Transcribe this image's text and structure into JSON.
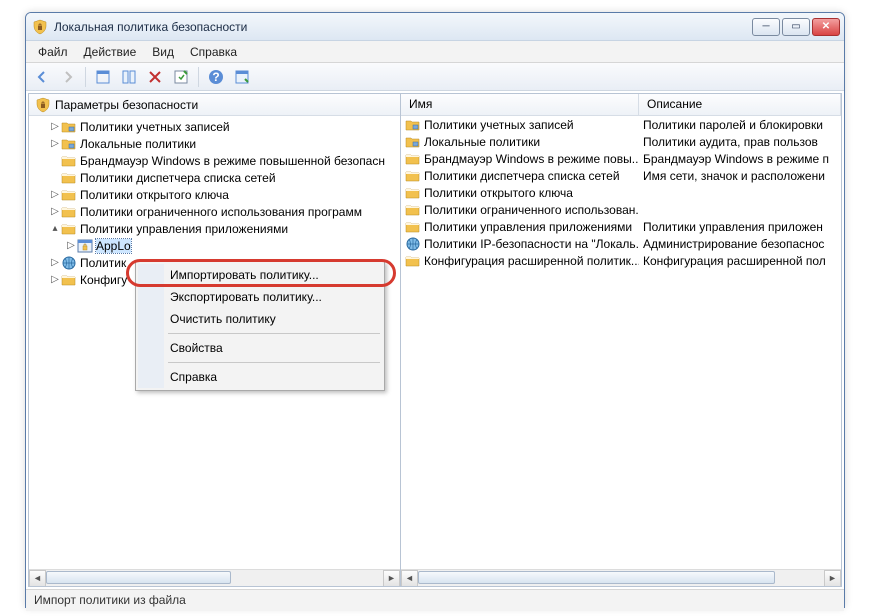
{
  "window": {
    "title": "Локальная политика безопасности"
  },
  "menubar": [
    "Файл",
    "Действие",
    "Вид",
    "Справка"
  ],
  "tree_header": "Параметры безопасности",
  "tree": [
    {
      "depth": 1,
      "exp": "▷",
      "icon": "folder-group",
      "label": "Политики учетных записей"
    },
    {
      "depth": 1,
      "exp": "▷",
      "icon": "folder-group",
      "label": "Локальные политики"
    },
    {
      "depth": 1,
      "exp": "",
      "icon": "folder",
      "label": "Брандмауэр Windows в режиме повышенной безопасн"
    },
    {
      "depth": 1,
      "exp": "",
      "icon": "folder",
      "label": "Политики диспетчера списка сетей"
    },
    {
      "depth": 1,
      "exp": "▷",
      "icon": "folder",
      "label": "Политики открытого ключа"
    },
    {
      "depth": 1,
      "exp": "▷",
      "icon": "folder",
      "label": "Политики ограниченного использования программ"
    },
    {
      "depth": 1,
      "exp": "▴",
      "icon": "folder",
      "label": "Политики управления приложениями"
    },
    {
      "depth": 2,
      "exp": "▷",
      "icon": "applocker",
      "label": "AppLo",
      "selected": true
    },
    {
      "depth": 1,
      "exp": "▷",
      "icon": "globe",
      "label": "Политик"
    },
    {
      "depth": 1,
      "exp": "▷",
      "icon": "folder",
      "label": "Конфигу"
    }
  ],
  "list_columns": {
    "name": "Имя",
    "desc": "Описание"
  },
  "list": [
    {
      "icon": "folder-group",
      "name": "Политики учетных записей",
      "desc": "Политики паролей и блокировки"
    },
    {
      "icon": "folder-group",
      "name": "Локальные политики",
      "desc": "Политики аудита, прав пользов"
    },
    {
      "icon": "folder",
      "name": "Брандмауэр Windows в режиме повы...",
      "desc": "Брандмауэр Windows в режиме п"
    },
    {
      "icon": "folder",
      "name": "Политики диспетчера списка сетей",
      "desc": "Имя сети, значок и расположени"
    },
    {
      "icon": "folder",
      "name": "Политики открытого ключа",
      "desc": ""
    },
    {
      "icon": "folder",
      "name": "Политики ограниченного использован...",
      "desc": ""
    },
    {
      "icon": "folder",
      "name": "Политики управления приложениями",
      "desc": "Политики управления приложен"
    },
    {
      "icon": "globe",
      "name": "Политики IP-безопасности на \"Локаль...",
      "desc": "Администрирование безопаснос"
    },
    {
      "icon": "folder",
      "name": "Конфигурация расширенной политик...",
      "desc": "Конфигурация расширенной пол"
    }
  ],
  "context_menu": [
    {
      "label": "Импортировать политику...",
      "highlighted": true
    },
    {
      "label": "Экспортировать политику..."
    },
    {
      "label": "Очистить политику"
    },
    {
      "sep": true
    },
    {
      "label": "Свойства"
    },
    {
      "sep": true
    },
    {
      "label": "Справка"
    }
  ],
  "statusbar": "Импорт политики из файла",
  "toolbar_icons": [
    "back",
    "forward",
    "|",
    "up",
    "pane",
    "delete",
    "props",
    "|",
    "help",
    "help2"
  ]
}
